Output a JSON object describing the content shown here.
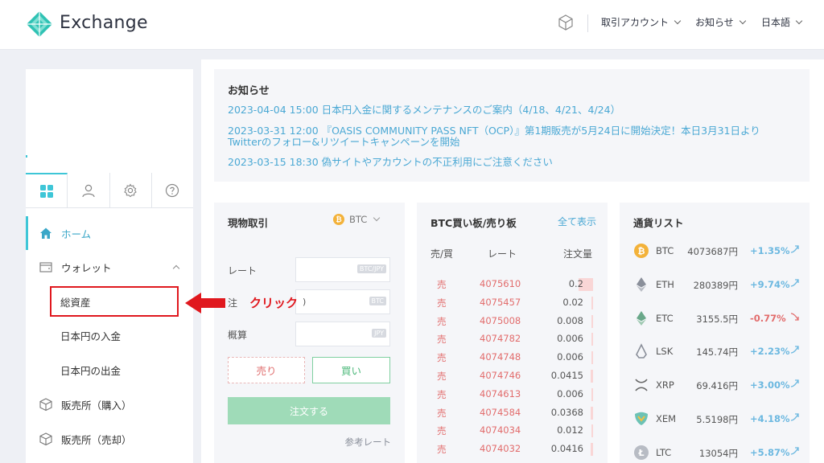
{
  "header": {
    "brand": "Exchange",
    "menus": [
      {
        "label": "取引アカウント"
      },
      {
        "label": "お知らせ"
      },
      {
        "label": "日本語"
      }
    ]
  },
  "sidebar": {
    "tabs": [
      "dashboard",
      "account",
      "settings",
      "help"
    ],
    "items": {
      "home": "ホーム",
      "wallet": "ウォレット",
      "total_assets": "総資産",
      "jpy_deposit": "日本円の入金",
      "jpy_withdraw": "日本円の出金",
      "buy_shop": "販売所（購入）",
      "sell_shop": "販売所（売却）"
    }
  },
  "annotation": {
    "label": "クリック",
    "color": "#e0181e"
  },
  "notice": {
    "title": "お知らせ",
    "items": [
      "2023-04-04 15:00 日本円入金に関するメンテナンスのご案内（4/18、4/21、4/24）",
      "2023-03-31 12:00 『OASIS COMMUNITY PASS NFT（OCP）』第1期販売が5月24日に開始決定！本日3月31日より",
      "Twitterのフォロー&リツイートキャンペーンを開始",
      "2023-03-15 18:30 偽サイトやアカウントの不正利用にご注意ください"
    ]
  },
  "spot": {
    "title": "現物取引",
    "coin": "BTC",
    "coin_glyph": "₿",
    "rate_label": "レート",
    "rate_unit": "BTC/JPY",
    "qty_label": "注",
    "qty_value": ")",
    "qty_unit": "BTC",
    "estimate_label": "概算",
    "estimate_unit": "JPY",
    "sell": "売り",
    "buy": "買い",
    "order": "注文する",
    "ref": "参考レート"
  },
  "orderbook": {
    "title": "BTC買い板/売り板",
    "show_all": "全て表示",
    "headers": {
      "side": "売/買",
      "rate": "レート",
      "qty": "注文量"
    },
    "rows": [
      {
        "side": "売",
        "rate": "4075610",
        "qty": "0.2",
        "depth": 0.9
      },
      {
        "side": "売",
        "rate": "4075457",
        "qty": "0.02",
        "depth": 0.05
      },
      {
        "side": "売",
        "rate": "4075008",
        "qty": "0.008",
        "depth": 0.05
      },
      {
        "side": "売",
        "rate": "4074782",
        "qty": "0.006",
        "depth": 0.05
      },
      {
        "side": "売",
        "rate": "4074748",
        "qty": "0.006",
        "depth": 0.05
      },
      {
        "side": "売",
        "rate": "4074746",
        "qty": "0.0415",
        "depth": 0.15
      },
      {
        "side": "売",
        "rate": "4074613",
        "qty": "0.006",
        "depth": 0.05
      },
      {
        "side": "売",
        "rate": "4074584",
        "qty": "0.0368",
        "depth": 0.15
      },
      {
        "side": "売",
        "rate": "4074034",
        "qty": "0.012",
        "depth": 0.05
      },
      {
        "side": "売",
        "rate": "4074032",
        "qty": "0.0416",
        "depth": 0.15
      }
    ]
  },
  "currencies": {
    "title": "通貨リスト",
    "rows": [
      {
        "symbol": "BTC",
        "price": "4073687円",
        "change": "+1.35%",
        "up": true,
        "icon": "btc-icon"
      },
      {
        "symbol": "ETH",
        "price": "280389円",
        "change": "+9.74%",
        "up": true,
        "icon": "eth-icon"
      },
      {
        "symbol": "ETC",
        "price": "3155.5円",
        "change": "-0.77%",
        "up": false,
        "icon": "etc-icon"
      },
      {
        "symbol": "LSK",
        "price": "145.74円",
        "change": "+2.23%",
        "up": true,
        "icon": "lsk-icon"
      },
      {
        "symbol": "XRP",
        "price": "69.416円",
        "change": "+3.00%",
        "up": true,
        "icon": "xrp-icon"
      },
      {
        "symbol": "XEM",
        "price": "5.5198円",
        "change": "+4.18%",
        "up": true,
        "icon": "xem-icon"
      },
      {
        "symbol": "LTC",
        "price": "13054円",
        "change": "+5.87%",
        "up": true,
        "icon": "ltc-icon"
      }
    ],
    "colors": {
      "up": "#6cb8e0",
      "down": "#e26c6c"
    }
  }
}
